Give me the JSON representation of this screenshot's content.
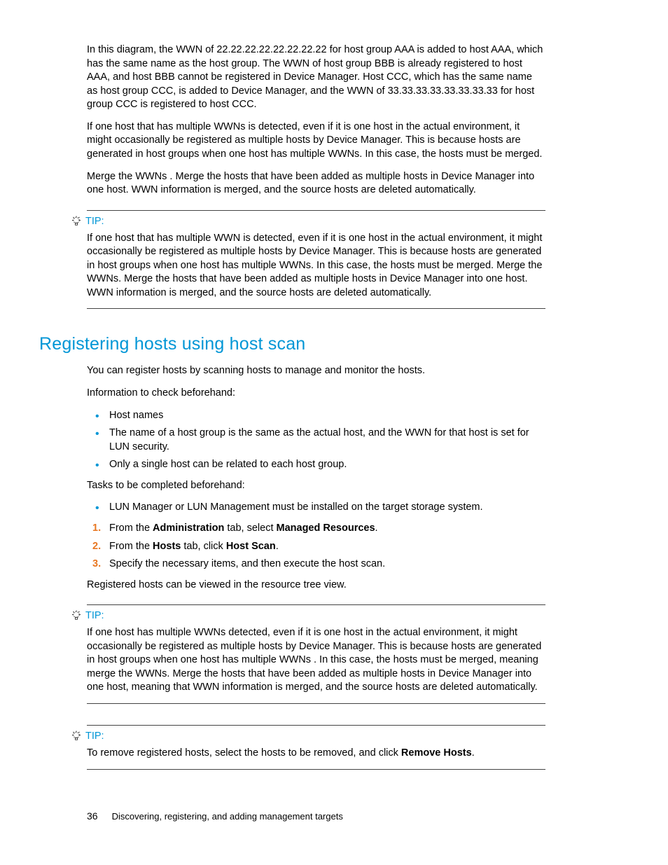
{
  "intro": {
    "p1": "In this diagram, the WWN of 22.22.22.22.22.22.22.22 for host group AAA is added to host AAA, which has the same name as the host group. The WWN of host group BBB is already registered to host AAA, and host BBB cannot be registered in Device Manager. Host CCC, which has the same name as host group CCC, is added to Device Manager, and the WWN of 33.33.33.33.33.33.33.33 for host group CCC is registered to host CCC.",
    "p2": "If one host that has multiple WWNs is detected, even if it is one host in the actual environment, it might occasionally be registered as multiple hosts by Device Manager. This is because hosts are generated in host groups when one host has multiple WWNs. In this case, the hosts must be merged.",
    "p3": "Merge the WWNs . Merge the hosts that have been added as multiple hosts in Device Manager into one host. WWN information is merged, and the source hosts are deleted automatically."
  },
  "tip1": {
    "label": "TIP:",
    "text": "If one host that has multiple WWN is detected, even if it is one host in the actual environment, it might occasionally be registered as multiple hosts by Device Manager. This is because hosts are generated in host groups when one host has multiple WWNs. In this case, the hosts must be merged. Merge the WWNs. Merge the hosts that have been added as multiple hosts in Device Manager into one host. WWN information is merged, and the source hosts are deleted automatically."
  },
  "section": {
    "heading": "Registering hosts using host scan",
    "p1": "You can register hosts by scanning hosts to manage and monitor the hosts.",
    "p2": "Information to check beforehand:",
    "bullets1": [
      "Host names",
      "The name of a host group is the same as the actual host, and the WWN for that host is set for LUN security.",
      "Only a single host can be related to each host group."
    ],
    "p3": "Tasks to be completed beforehand:",
    "bullets2": [
      "LUN Manager or LUN Management must be installed on the target storage system."
    ],
    "steps": [
      {
        "pre": "From the ",
        "b1": "Administration",
        "mid": " tab, select ",
        "b2": "Managed Resources",
        "post": "."
      },
      {
        "pre": "From the ",
        "b1": "Hosts",
        "mid": " tab, click ",
        "b2": "Host Scan",
        "post": "."
      },
      {
        "pre": "Specify the necessary items, and then execute the host scan.",
        "b1": "",
        "mid": "",
        "b2": "",
        "post": ""
      }
    ],
    "p4": "Registered hosts can be viewed in the resource tree view."
  },
  "tip2": {
    "label": "TIP:",
    "text": "If one host has multiple WWNs detected, even if it is one host in the actual environment, it might occasionally be registered as multiple hosts by Device Manager. This is because hosts are generated in host groups when one host has multiple WWNs . In this case, the hosts must be merged, meaning merge the WWNs. Merge the hosts that have been added as multiple hosts in Device Manager into one host, meaning that WWN information is merged, and the source hosts are deleted automatically."
  },
  "tip3": {
    "label": "TIP:",
    "pre": "To remove registered hosts, select the hosts to be removed, and click ",
    "b": "Remove Hosts",
    "post": "."
  },
  "footer": {
    "page": "36",
    "chapter": "Discovering, registering, and adding management targets"
  }
}
